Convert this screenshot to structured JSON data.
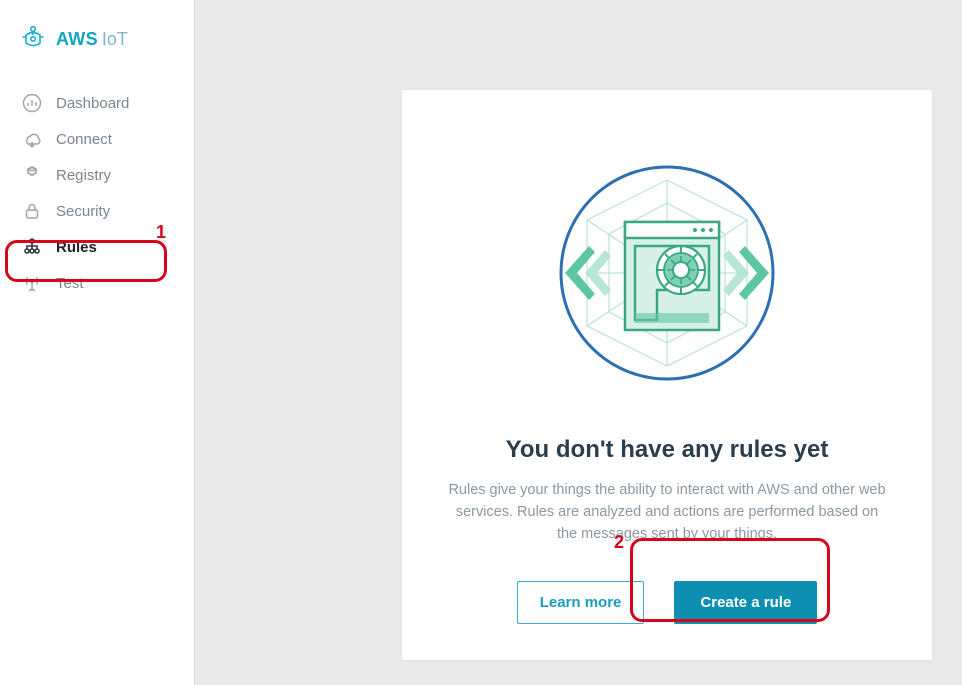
{
  "brand": {
    "name": "AWS",
    "suffix": "IoT"
  },
  "sidebar": {
    "items": [
      {
        "label": "Dashboard"
      },
      {
        "label": "Connect"
      },
      {
        "label": "Registry"
      },
      {
        "label": "Security"
      },
      {
        "label": "Rules"
      },
      {
        "label": "Test"
      }
    ]
  },
  "empty_state": {
    "title": "You don't have any rules yet",
    "description": "Rules give your things the ability to interact with AWS and other web services. Rules are analyzed and actions are performed based on the messages sent by your things.",
    "learn_more": "Learn more",
    "create": "Create a rule"
  },
  "annotations": {
    "a1": "1",
    "a2": "2"
  }
}
